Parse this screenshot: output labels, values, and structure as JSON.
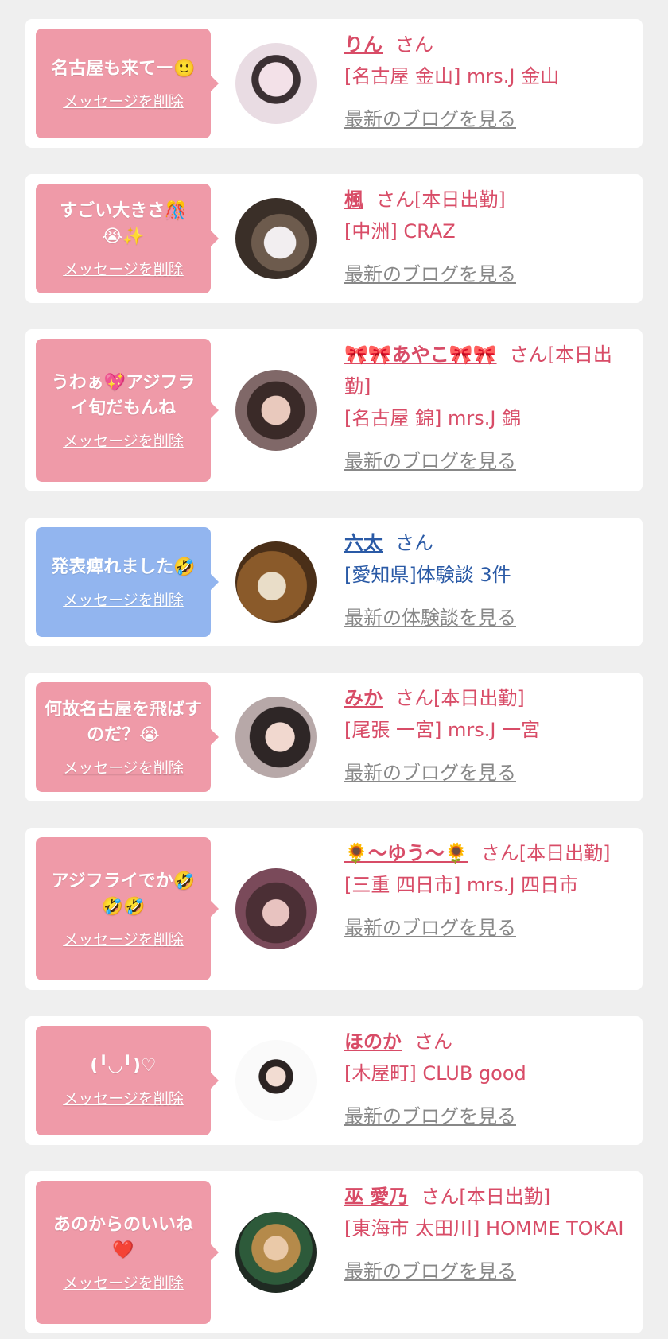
{
  "colors": {
    "pink_text": "#d84c67",
    "blue_text": "#2a5aa6",
    "bubble_pink": "#ef9aa8",
    "bubble_blue": "#92b5ef",
    "gray_link": "#888888"
  },
  "cards": [
    {
      "message": "名古屋も来てー🙂",
      "delete": "メッセージを削除",
      "name": "りん",
      "suffix": "さん",
      "location": "[名古屋 金山] mrs.J 金山",
      "link": "最新のブログを見る",
      "theme": "pink"
    },
    {
      "message": "すごい大きさ🎊\n😭✨",
      "delete": "メッセージを削除",
      "name": "楓",
      "suffix": "さん[本日出勤]",
      "location": "[中洲] CRAZ",
      "link": "最新のブログを見る",
      "theme": "pink"
    },
    {
      "message": "うわぁ💖アジフライ旬だもんね",
      "delete": "メッセージを削除",
      "name": "🎀🎀あやこ🎀🎀",
      "suffix": "さん[本日出勤]",
      "location": "[名古屋 錦] mrs.J 錦",
      "link": "最新のブログを見る",
      "theme": "pink"
    },
    {
      "message": "発表痺れました🤣",
      "delete": "メッセージを削除",
      "name": "六太",
      "suffix": "さん",
      "location": "[愛知県]体験談 3件",
      "link": "最新の体験談を見る",
      "theme": "blue"
    },
    {
      "message": "何故名古屋を飛ばすのだ？😭",
      "delete": "メッセージを削除",
      "name": "みか",
      "suffix": "さん[本日出勤]",
      "location": "[尾張 一宮] mrs.J 一宮",
      "link": "最新のブログを見る",
      "theme": "pink"
    },
    {
      "message": "アジフライでか🤣🤣🤣",
      "delete": "メッセージを削除",
      "name": "🌻〜ゆう〜🌻",
      "suffix": "さん[本日出勤]",
      "location": "[三重 四日市] mrs.J 四日市",
      "link": "最新のブログを見る",
      "theme": "pink"
    },
    {
      "message": "(╹◡╹)♡",
      "delete": "メッセージを削除",
      "name": "ほのか",
      "suffix": "さん",
      "location": "[木屋町] CLUB good",
      "link": "最新のブログを見る",
      "theme": "pink"
    },
    {
      "message": "あのからのいいね❤️",
      "delete": "メッセージを削除",
      "name": "巫 愛乃",
      "suffix": "さん[本日出勤]",
      "location": "[東海市 太田川] HOMME TOKAI",
      "link": "最新のブログを見る",
      "theme": "pink"
    }
  ]
}
